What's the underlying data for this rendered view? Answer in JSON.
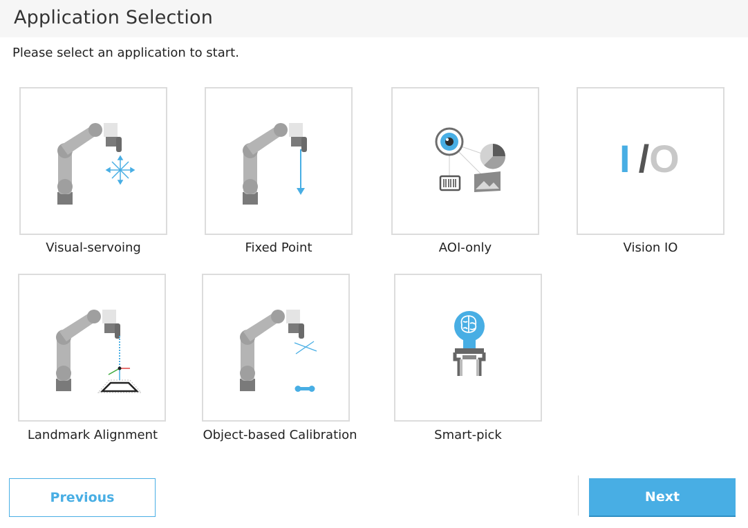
{
  "header": {
    "title": "Application Selection"
  },
  "instructions": "Please select an application to start.",
  "applications": [
    {
      "label": "Visual-servoing"
    },
    {
      "label": "Fixed Point"
    },
    {
      "label": "AOI-only"
    },
    {
      "label": "Vision IO"
    },
    {
      "label": "Landmark Alignment"
    },
    {
      "label": "Object-based Calibration"
    },
    {
      "label": "Smart-pick"
    }
  ],
  "vision_io_glyph": {
    "i": "I",
    "slash": "/",
    "o": "O"
  },
  "footer": {
    "previous_label": "Previous",
    "next_label": "Next"
  },
  "colors": {
    "accent": "#48aee4",
    "robot_gray": "#a6a6a6",
    "tile_border": "#dcdcdc"
  }
}
